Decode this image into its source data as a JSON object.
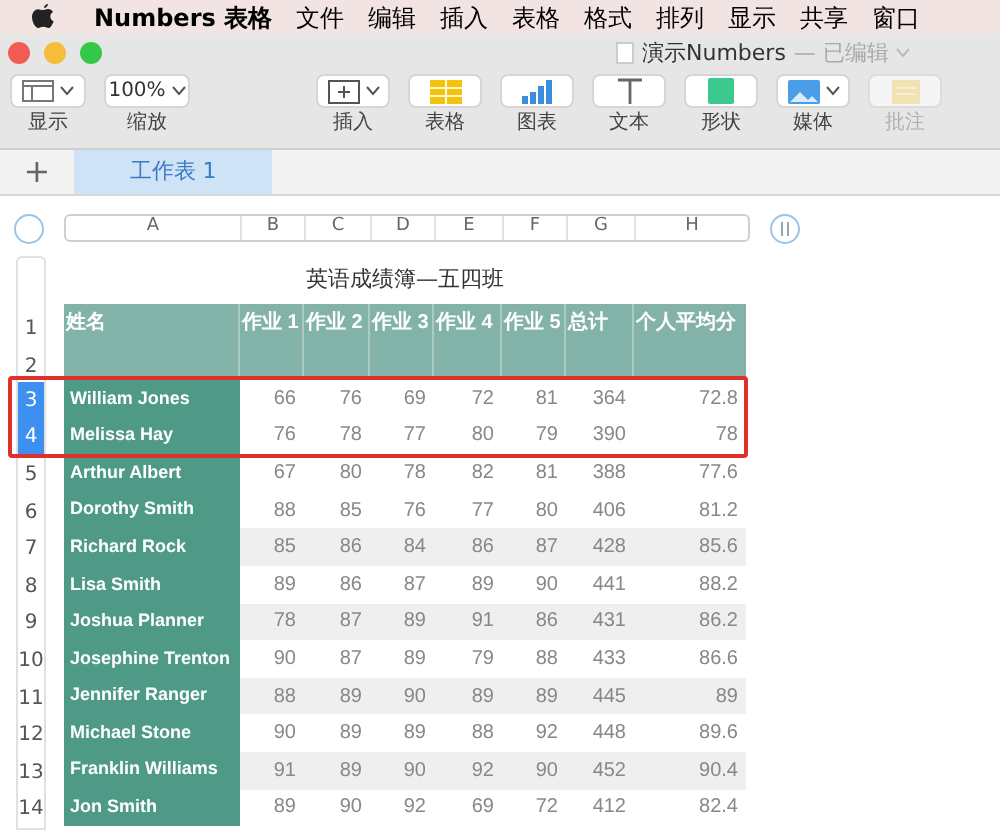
{
  "menu_bar": {
    "app": "Numbers 表格",
    "items": [
      "文件",
      "编辑",
      "插入",
      "表格",
      "格式",
      "排列",
      "显示",
      "共享",
      "窗口"
    ]
  },
  "window": {
    "title": "演示Numbers",
    "status": "— 已编辑"
  },
  "toolbar": [
    {
      "kind": "sidebar",
      "label": "显示",
      "disabled": false
    },
    {
      "kind": "zoom",
      "value": "100%",
      "label": "缩放",
      "disabled": false
    },
    {
      "kind": "insert",
      "label": "插入",
      "disabled": false
    },
    {
      "kind": "table",
      "label": "表格",
      "disabled": false
    },
    {
      "kind": "chart",
      "label": "图表",
      "disabled": false
    },
    {
      "kind": "text",
      "label": "文本",
      "disabled": false
    },
    {
      "kind": "shape",
      "label": "形状",
      "disabled": false
    },
    {
      "kind": "media",
      "label": "媒体",
      "disabled": false
    },
    {
      "kind": "comment",
      "label": "批注",
      "disabled": true
    }
  ],
  "sheet_tabs": {
    "add": "+",
    "tabs": [
      {
        "label": "工作表 1",
        "selected": true
      }
    ]
  },
  "table": {
    "columns": [
      "A",
      "B",
      "C",
      "D",
      "E",
      "F",
      "G",
      "H"
    ],
    "title": "英语成绩簿—五四班",
    "header_row_numbers": [
      "1",
      "2"
    ],
    "header": [
      "姓名",
      "作业 1",
      "作业 2",
      "作业 3",
      "作业 4",
      "作业 5",
      "总计",
      "个人平均分"
    ],
    "rows": [
      {
        "num": "3",
        "selected": true,
        "shaded": false,
        "cells": [
          "William Jones",
          "66",
          "76",
          "69",
          "72",
          "81",
          "364",
          "72.8"
        ]
      },
      {
        "num": "4",
        "selected": true,
        "shaded": false,
        "cells": [
          "Melissa Hay",
          "76",
          "78",
          "77",
          "80",
          "79",
          "390",
          "78"
        ]
      },
      {
        "num": "5",
        "selected": false,
        "shaded": false,
        "cells": [
          "Arthur Albert",
          "67",
          "80",
          "78",
          "82",
          "81",
          "388",
          "77.6"
        ]
      },
      {
        "num": "6",
        "selected": false,
        "shaded": false,
        "cells": [
          "Dorothy Smith",
          "88",
          "85",
          "76",
          "77",
          "80",
          "406",
          "81.2"
        ]
      },
      {
        "num": "7",
        "selected": false,
        "shaded": true,
        "cells": [
          "Richard Rock",
          "85",
          "86",
          "84",
          "86",
          "87",
          "428",
          "85.6"
        ]
      },
      {
        "num": "8",
        "selected": false,
        "shaded": false,
        "cells": [
          "Lisa Smith",
          "89",
          "86",
          "87",
          "89",
          "90",
          "441",
          "88.2"
        ]
      },
      {
        "num": "9",
        "selected": false,
        "shaded": true,
        "cells": [
          "Joshua Planner",
          "78",
          "87",
          "89",
          "91",
          "86",
          "431",
          "86.2"
        ]
      },
      {
        "num": "10",
        "selected": false,
        "shaded": false,
        "cells": [
          "Josephine Trenton",
          "90",
          "87",
          "89",
          "79",
          "88",
          "433",
          "86.6"
        ]
      },
      {
        "num": "11",
        "selected": false,
        "shaded": true,
        "cells": [
          "Jennifer Ranger",
          "88",
          "89",
          "90",
          "89",
          "89",
          "445",
          "89"
        ]
      },
      {
        "num": "12",
        "selected": false,
        "shaded": false,
        "cells": [
          "Michael Stone",
          "90",
          "89",
          "89",
          "88",
          "92",
          "448",
          "89.6"
        ]
      },
      {
        "num": "13",
        "selected": false,
        "shaded": true,
        "cells": [
          "Franklin Williams",
          "91",
          "89",
          "90",
          "92",
          "90",
          "452",
          "90.4"
        ]
      },
      {
        "num": "14",
        "selected": false,
        "shaded": false,
        "cells": [
          "Jon Smith",
          "89",
          "90",
          "92",
          "69",
          "72",
          "412",
          "82.4"
        ]
      }
    ]
  }
}
